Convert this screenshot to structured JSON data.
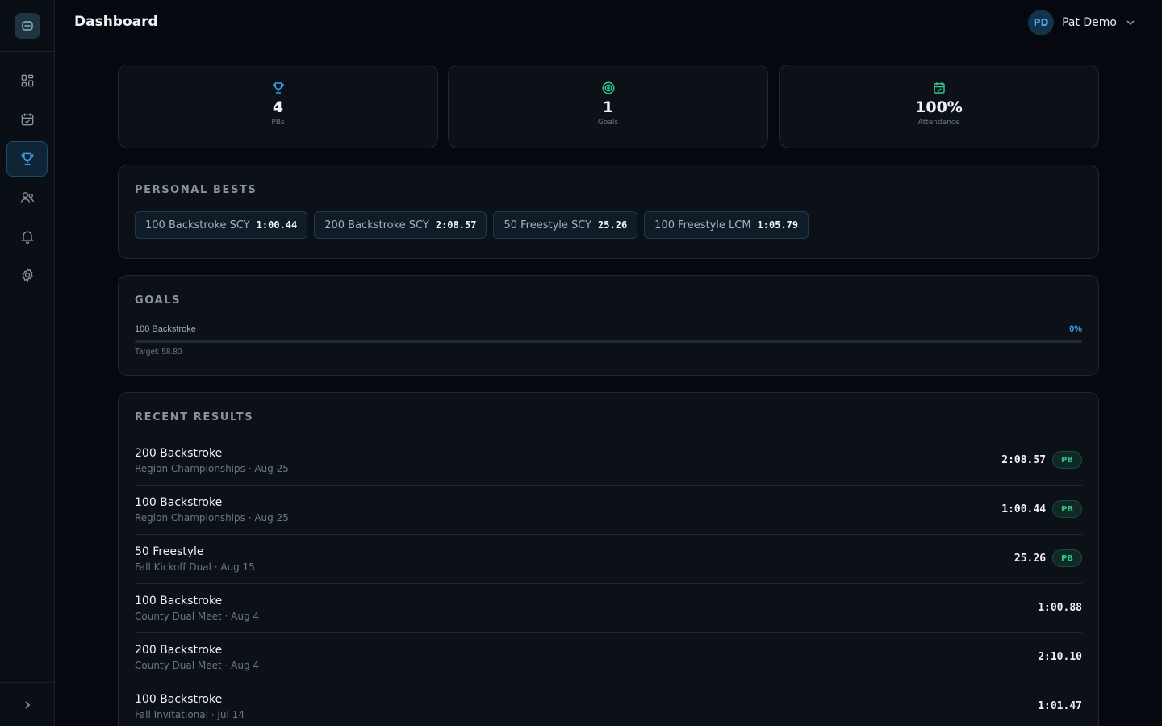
{
  "header": {
    "title": "Dashboard"
  },
  "user": {
    "initials": "PD",
    "name": "Pat Demo"
  },
  "sidebar": {
    "items": [
      {
        "name": "dashboard",
        "icon": "grid-icon",
        "active": false
      },
      {
        "name": "calendar",
        "icon": "calendar-check-icon",
        "active": false
      },
      {
        "name": "results",
        "icon": "trophy-icon",
        "active": true
      },
      {
        "name": "team",
        "icon": "users-icon",
        "active": false
      },
      {
        "name": "notifications",
        "icon": "bell-icon",
        "active": false
      },
      {
        "name": "settings",
        "icon": "gear-icon",
        "active": false
      }
    ]
  },
  "stats": [
    {
      "value": "4",
      "label": "PBs",
      "icon": "trophy-icon",
      "color": "#3b9ee0"
    },
    {
      "value": "1",
      "label": "Goals",
      "icon": "target-icon",
      "color": "#2ec48e"
    },
    {
      "value": "100%",
      "label": "Attendance",
      "icon": "calendar-check-icon",
      "color": "#2ec48e"
    }
  ],
  "personal_bests": {
    "title": "PERSONAL BESTS",
    "items": [
      {
        "event": "100 Backstroke SCY",
        "time": "1:00.44"
      },
      {
        "event": "200 Backstroke SCY",
        "time": "2:08.57"
      },
      {
        "event": "50 Freestyle SCY",
        "time": "25.26"
      },
      {
        "event": "100 Freestyle LCM",
        "time": "1:05.79"
      }
    ]
  },
  "goals": {
    "title": "GOALS",
    "items": [
      {
        "event": "100 Backstroke",
        "percent_label": "0%",
        "progress": 0,
        "target": "Target: 58.80"
      }
    ]
  },
  "recent_results": {
    "title": "RECENT RESULTS",
    "badge_label": "PB",
    "items": [
      {
        "event": "200 Backstroke",
        "meta": "Region Championships · Aug 25",
        "time": "2:08.57",
        "pb": true
      },
      {
        "event": "100 Backstroke",
        "meta": "Region Championships · Aug 25",
        "time": "1:00.44",
        "pb": true
      },
      {
        "event": "50 Freestyle",
        "meta": "Fall Kickoff Dual · Aug 15",
        "time": "25.26",
        "pb": true
      },
      {
        "event": "100 Backstroke",
        "meta": "County Dual Meet · Aug 4",
        "time": "1:00.88",
        "pb": false
      },
      {
        "event": "200 Backstroke",
        "meta": "County Dual Meet · Aug 4",
        "time": "2:10.10",
        "pb": false
      },
      {
        "event": "100 Backstroke",
        "meta": "Fall Invitational · Jul 14",
        "time": "1:01.47",
        "pb": false
      }
    ]
  }
}
